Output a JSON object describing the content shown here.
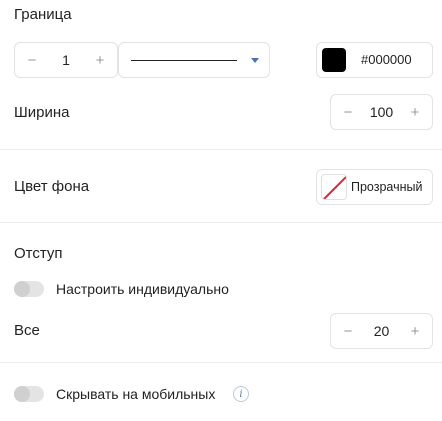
{
  "border": {
    "title": "Граница",
    "width_value": "1",
    "minus": "−",
    "plus": "+",
    "color_hex": "#000000",
    "color_swatch": "#000000",
    "line_style": "solid"
  },
  "width": {
    "label": "Ширина",
    "value": "100",
    "minus": "−",
    "plus": "+"
  },
  "background": {
    "label": "Цвет фона",
    "value": "Прозрачный",
    "indicator_color": "#e0242f"
  },
  "padding": {
    "title": "Отступ",
    "individual_label": "Настроить индивидуально",
    "individual_enabled": false,
    "all_label": "Все",
    "all_value": "20",
    "minus": "−",
    "plus": "+"
  },
  "mobile": {
    "hide_label": "Скрывать на мобильных",
    "hide_enabled": false,
    "info_glyph": "i"
  }
}
